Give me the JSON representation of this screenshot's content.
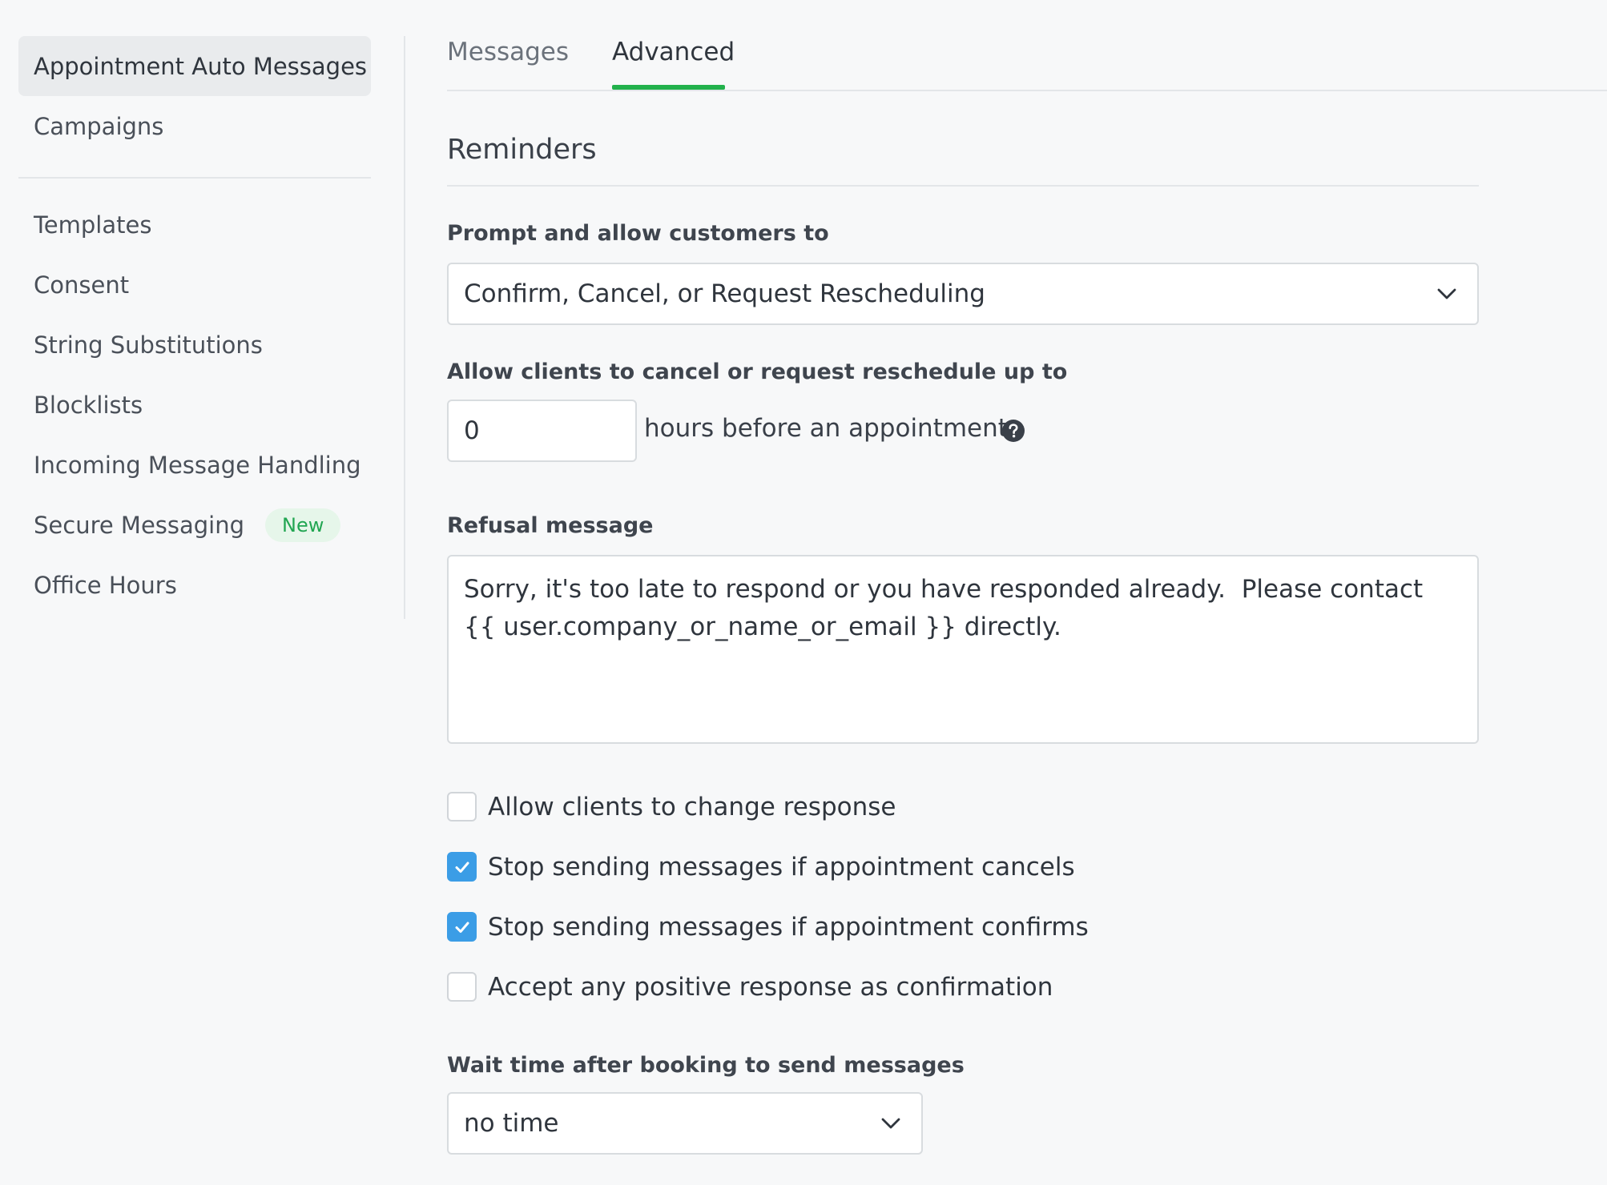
{
  "sidebar": {
    "primary": [
      {
        "label": "Appointment Auto Messages",
        "active": true
      },
      {
        "label": "Campaigns",
        "active": false
      }
    ],
    "secondary": [
      {
        "label": "Templates"
      },
      {
        "label": "Consent"
      },
      {
        "label": "String Substitutions"
      },
      {
        "label": "Blocklists"
      },
      {
        "label": "Incoming Message Handling"
      },
      {
        "label": "Secure Messaging",
        "badge": "New"
      },
      {
        "label": "Office Hours"
      }
    ]
  },
  "tabs": [
    {
      "label": "Messages",
      "active": false
    },
    {
      "label": "Advanced",
      "active": true
    }
  ],
  "section": {
    "title": "Reminders"
  },
  "form": {
    "prompt": {
      "label": "Prompt and allow customers to",
      "value": "Confirm, Cancel, or Request Rescheduling"
    },
    "cutoff": {
      "label": "Allow clients to cancel or request reschedule up to",
      "value": "0",
      "suffix": "hours before an appointment."
    },
    "refusal": {
      "label": "Refusal message",
      "value": "Sorry, it's too late to respond or you have responded already.  Please contact {{ user.company_or_name_or_email }} directly."
    },
    "checkboxes": [
      {
        "label": "Allow clients to change response",
        "checked": false
      },
      {
        "label": "Stop sending messages if appointment cancels",
        "checked": true
      },
      {
        "label": "Stop sending messages if appointment confirms",
        "checked": true
      },
      {
        "label": "Accept any positive response as confirmation",
        "checked": false
      }
    ],
    "wait": {
      "label": "Wait time after booking to send messages",
      "value": "no time"
    }
  },
  "colors": {
    "accent_green": "#22b14c",
    "checkbox_blue": "#3b9de6",
    "badge_green_text": "#22a652",
    "badge_green_bg": "#e6f6ea"
  },
  "icons": {
    "select_arrow": "chevron-down-icon",
    "help": "question-circle-icon",
    "check": "checkmark-icon"
  }
}
